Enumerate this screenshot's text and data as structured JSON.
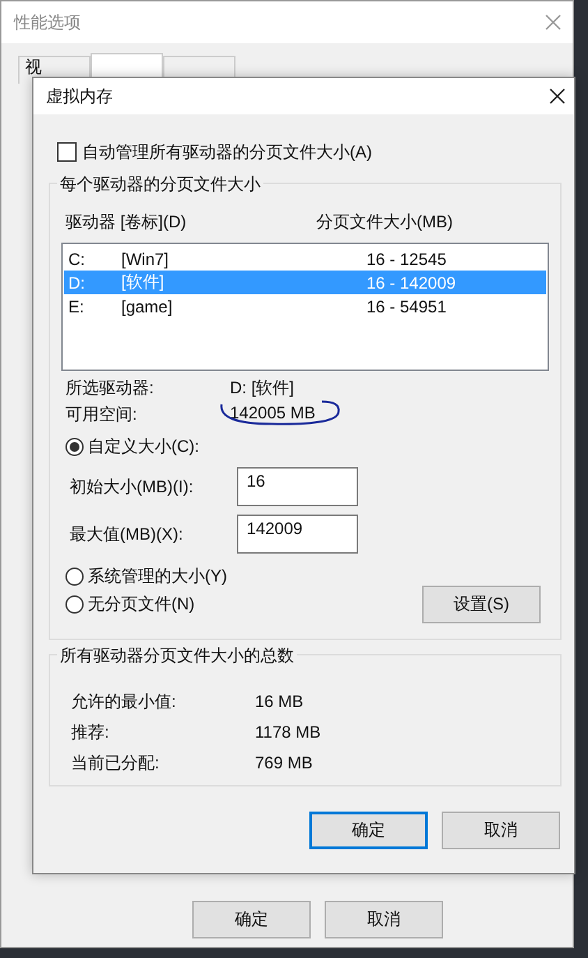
{
  "back_window": {
    "title": "性能选项",
    "tabs": [
      {
        "label": "视",
        "selected": false
      },
      {
        "selected": true
      },
      {
        "selected": false
      }
    ],
    "buttons": [
      {
        "label": "确定"
      },
      {
        "label": "取消"
      }
    ]
  },
  "dialog": {
    "title": "虚拟内存",
    "auto_manage": {
      "label": "自动管理所有驱动器的分页文件大小(A)",
      "checked": false
    },
    "per_drive": {
      "title": "每个驱动器的分页文件大小",
      "columns": [
        "驱动器 [卷标](D)",
        "分页文件大小(MB)"
      ],
      "drives": [
        {
          "drive": "C:",
          "label": "[Win7]",
          "size": "16 - 12545",
          "selected": false
        },
        {
          "drive": "D:",
          "label": "[软件]",
          "size": "16 - 142009",
          "selected": true
        },
        {
          "drive": "E:",
          "label": "[game]",
          "size": "16 - 54951",
          "selected": false
        }
      ],
      "selected_drive_label": "所选驱动器:",
      "selected_drive": "D:  [软件]",
      "free_space_label": "可用空间:",
      "free_space": "142005 MB",
      "options": [
        {
          "kind": "radio",
          "label": "自定义大小(C):",
          "selected": true
        },
        {
          "kind": "field",
          "label": "初始大小(MB)(I):",
          "value": "16"
        },
        {
          "kind": "field",
          "label": "最大值(MB)(X):",
          "value": "142009"
        },
        {
          "kind": "radio",
          "label": "系统管理的大小(Y)",
          "selected": false
        },
        {
          "kind": "radio",
          "label": "无分页文件(N)",
          "selected": false
        }
      ],
      "set_button": "设置(S)"
    },
    "totals": {
      "title": "所有驱动器分页文件大小的总数",
      "rows": [
        {
          "label": "允许的最小值:",
          "value": "16 MB"
        },
        {
          "label": "推荐:",
          "value": "1178 MB"
        },
        {
          "label": "当前已分配:",
          "value": "769 MB"
        }
      ]
    },
    "buttons": [
      {
        "label": "确定",
        "default": true
      },
      {
        "label": "取消",
        "default": false
      }
    ]
  }
}
